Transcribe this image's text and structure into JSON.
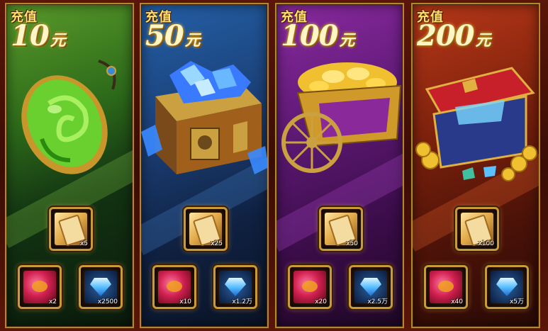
{
  "panels": [
    {
      "tag": "充值",
      "amount": "10",
      "unit": "元",
      "accent": "#5a9a2a",
      "treasure": "jade-pendant",
      "rewards": [
        {
          "icon": "scroll-icon",
          "count": "x5"
        },
        {
          "icon": "orb-icon",
          "count": "x2"
        },
        {
          "icon": "diamond-icon",
          "count": "x2500"
        }
      ]
    },
    {
      "tag": "充值",
      "amount": "50",
      "unit": "元",
      "accent": "#2460a8",
      "treasure": "crystal-chest",
      "rewards": [
        {
          "icon": "scroll-icon",
          "count": "x25"
        },
        {
          "icon": "orb-icon",
          "count": "x10"
        },
        {
          "icon": "diamond-icon",
          "count": "x1.2万"
        }
      ]
    },
    {
      "tag": "充值",
      "amount": "100",
      "unit": "元",
      "accent": "#8a2aa0",
      "treasure": "gold-ingot-cart",
      "rewards": [
        {
          "icon": "scroll-icon",
          "count": "x50"
        },
        {
          "icon": "orb-icon",
          "count": "x20"
        },
        {
          "icon": "diamond-icon",
          "count": "x2.5万"
        }
      ]
    },
    {
      "tag": "充值",
      "amount": "200",
      "unit": "元",
      "accent": "#b83818",
      "treasure": "treasure-chest",
      "rewards": [
        {
          "icon": "scroll-icon",
          "count": "x100"
        },
        {
          "icon": "orb-icon",
          "count": "x40"
        },
        {
          "icon": "diamond-icon",
          "count": "x5万"
        }
      ]
    }
  ]
}
